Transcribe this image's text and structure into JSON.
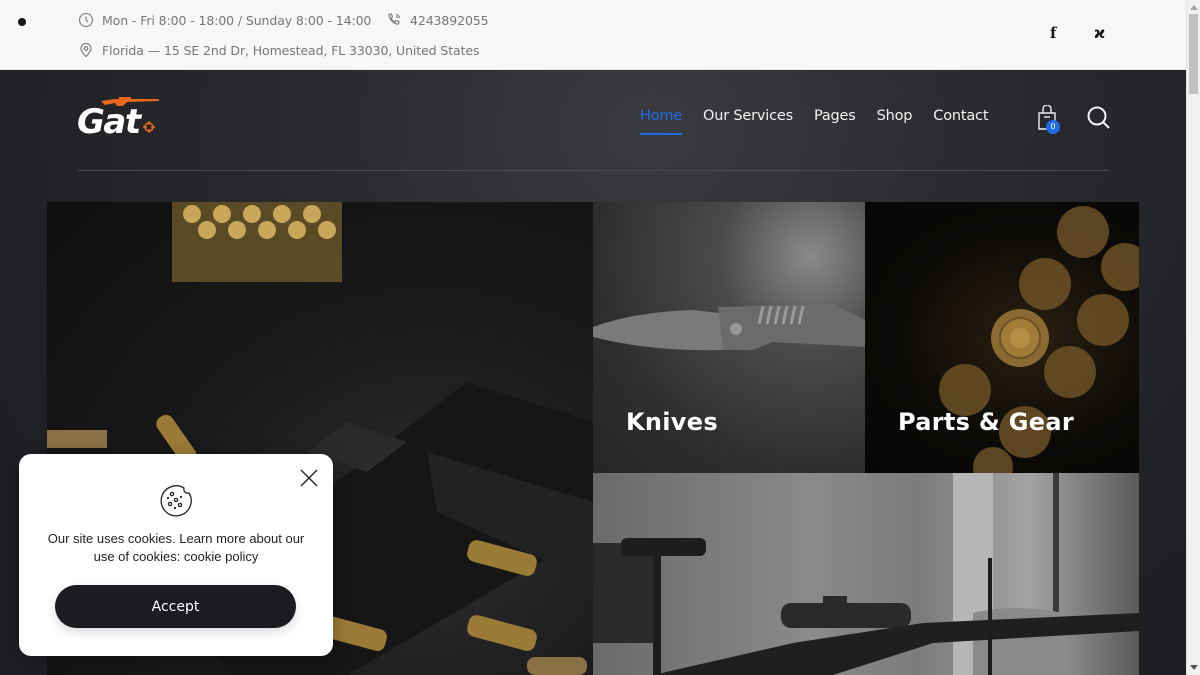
{
  "topbar": {
    "hours": "Mon - Fri 8:00 - 18:00 / Sunday 8:00 - 14:00",
    "phone": "4243892055",
    "address": "Florida — 15 SE 2nd Dr, Homestead, FL 33030, United States",
    "social": [
      {
        "name": "facebook-icon",
        "glyph": "f"
      },
      {
        "name": "xing-icon",
        "glyph": "ϰ"
      }
    ]
  },
  "header": {
    "logo_text": "Gat",
    "nav": [
      {
        "label": "Home",
        "active": true
      },
      {
        "label": "Our Services",
        "active": false
      },
      {
        "label": "Pages",
        "active": false
      },
      {
        "label": "Shop",
        "active": false
      },
      {
        "label": "Contact",
        "active": false
      }
    ],
    "cart_count": "0",
    "accent_color": "#1f6be6",
    "logo_accent_color": "#e8681e"
  },
  "gallery": {
    "tiles": [
      {
        "id": "pistol",
        "label": ""
      },
      {
        "id": "knives",
        "label": "Knives"
      },
      {
        "id": "parts",
        "label": "Parts & Gear"
      },
      {
        "id": "rifles",
        "label": ""
      }
    ]
  },
  "cookie": {
    "message": "Our site uses cookies. Learn more about our use of cookies: cookie policy",
    "accept_label": "Accept"
  }
}
